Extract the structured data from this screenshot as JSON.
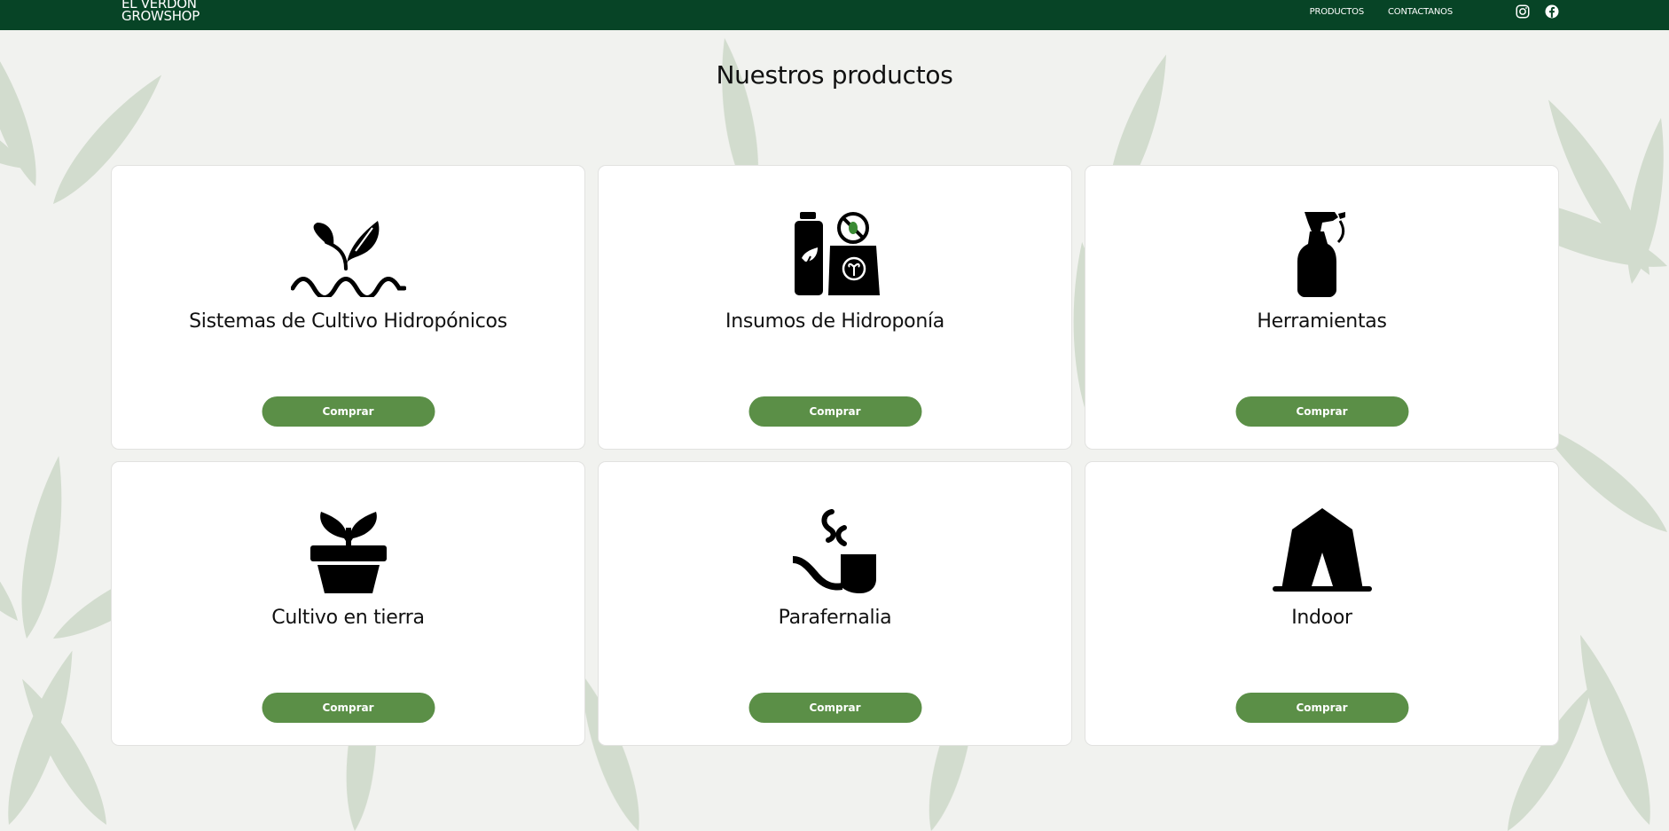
{
  "brand": {
    "line1": "EL VERDON",
    "line2": "GROWSHOP"
  },
  "nav": {
    "items": [
      {
        "label": "PRODUCTOS"
      },
      {
        "label": "CONTACTANOS"
      }
    ]
  },
  "social": [
    {
      "icon": "instagram-icon"
    },
    {
      "icon": "facebook-icon"
    }
  ],
  "page": {
    "title": "Nuestros productos"
  },
  "categories": [
    {
      "title": "Sistemas de Cultivo Hidropónicos",
      "icon": "hydroponic-plant-icon",
      "button": "Comprar"
    },
    {
      "title": "Insumos de Hidroponía",
      "icon": "nutrients-icon",
      "button": "Comprar"
    },
    {
      "title": "Herramientas",
      "icon": "spray-bottle-icon",
      "button": "Comprar"
    },
    {
      "title": "Cultivo en tierra",
      "icon": "potted-plant-icon",
      "button": "Comprar"
    },
    {
      "title": "Parafernalia",
      "icon": "pipe-icon",
      "button": "Comprar"
    },
    {
      "title": "Indoor",
      "icon": "grow-tent-icon",
      "button": "Comprar"
    }
  ],
  "colors": {
    "header": "#074426",
    "button": "#5b8f47",
    "background": "#f1f2ef",
    "leaf": "#c5d3bf"
  }
}
